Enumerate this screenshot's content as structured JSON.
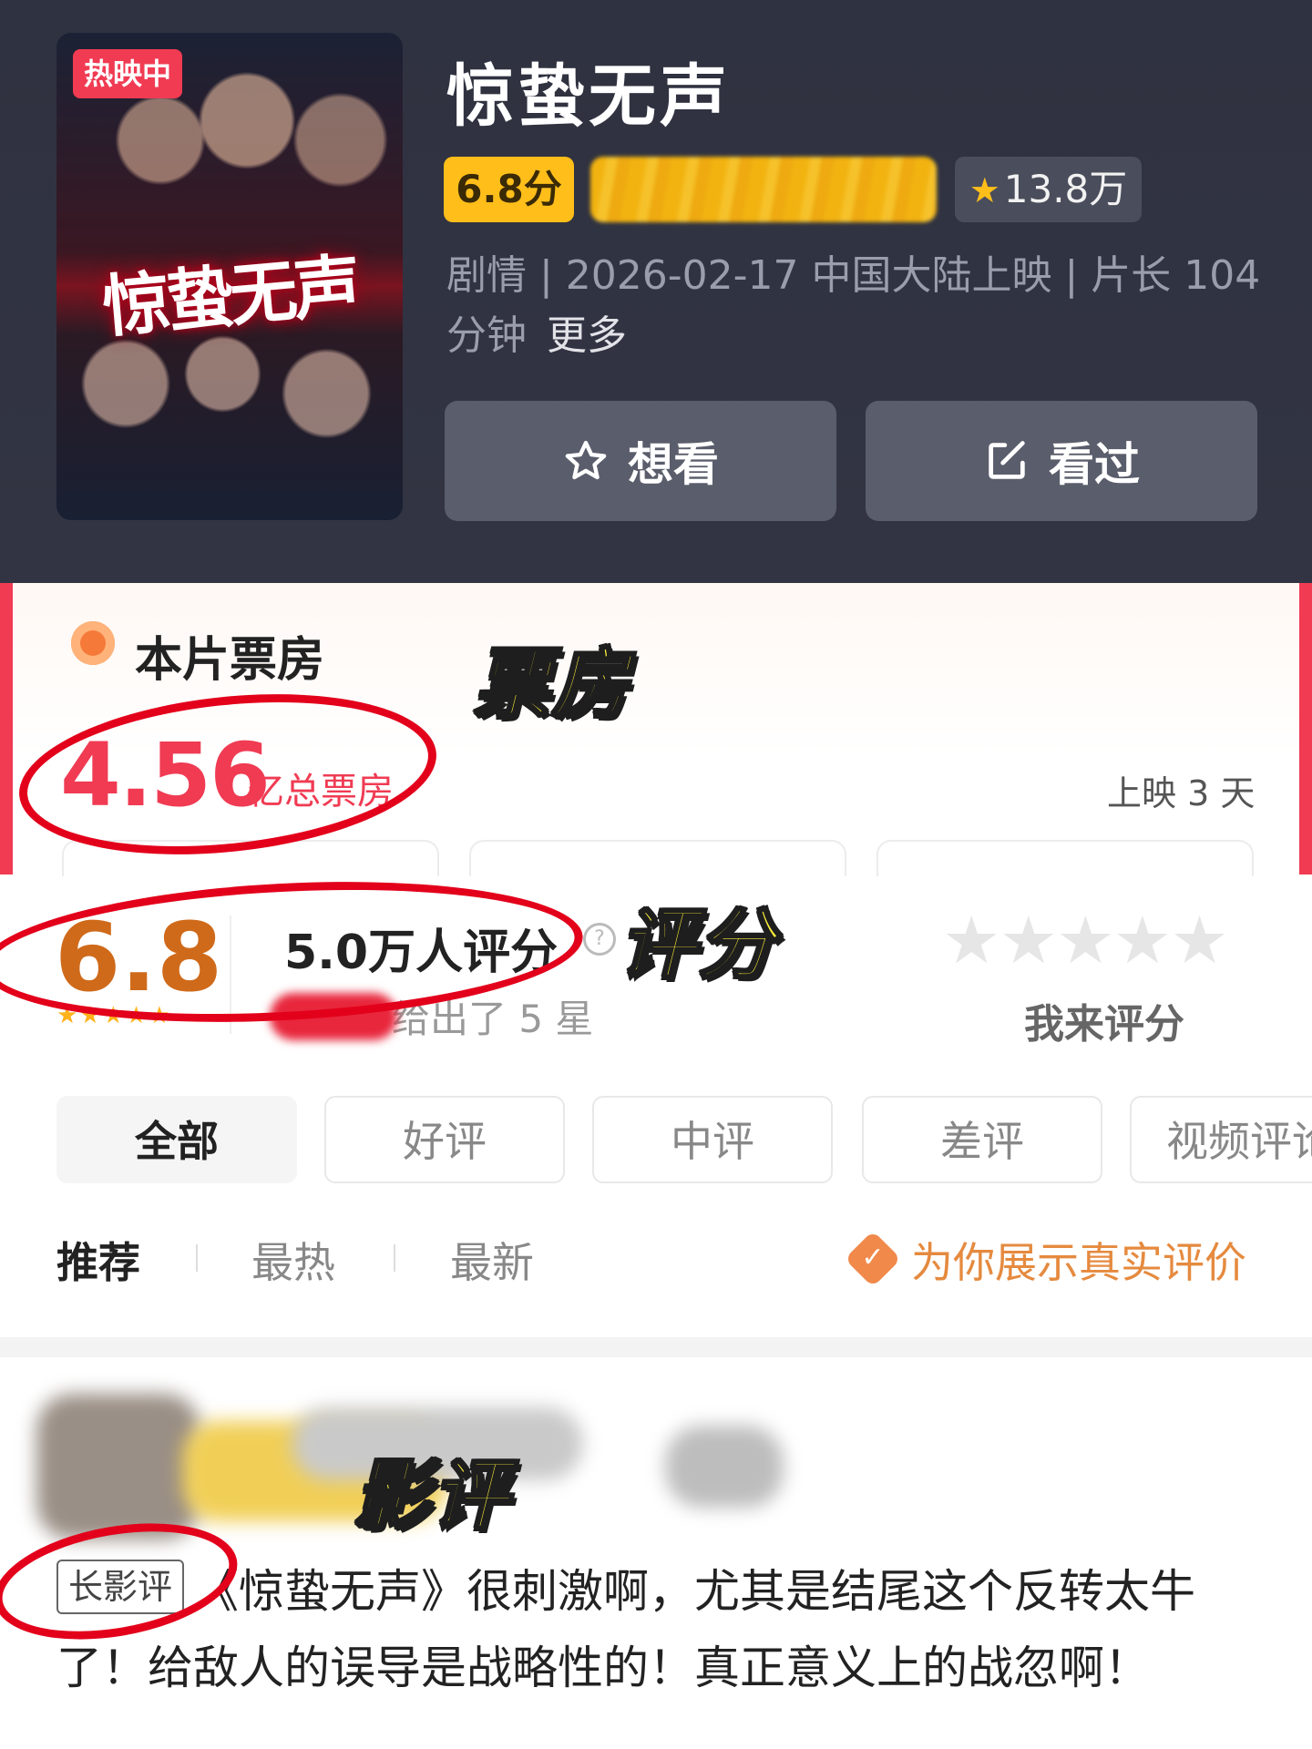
{
  "movie": {
    "status_badge": "热映中",
    "poster_title": "惊蛰无声",
    "title": "惊蛰无声",
    "score_label": "6.8分",
    "want_count": "13.8万",
    "info": "剧情 | 2026-02-17 中国大陆上映 | 片长 104分钟",
    "more_label": "更多",
    "want_button": "想看",
    "seen_button": "看过"
  },
  "box_office": {
    "heading": "本片票房",
    "value": "4.56",
    "unit": "亿总票房",
    "days": "上映 3 天"
  },
  "rating": {
    "score": "6.8",
    "stars_display": "★★★★★",
    "count_text": "5.0万人评分",
    "question_mark": "?",
    "sub_text": "给出了 5 星",
    "my_stars": "★★★★★",
    "rate_me": "我来评分"
  },
  "filters": {
    "tabs": [
      "全部",
      "好评",
      "中评",
      "差评",
      "视频评论"
    ],
    "sort": [
      "推荐",
      "最热",
      "最新"
    ],
    "real_review": "为你展示真实评价"
  },
  "review": {
    "tag": "长影评",
    "text": "《惊蛰无声》很刺激啊，尤其是结尾这个反转太牛了！给敌人的误导是战略性的！真正意义上的战忽啊！"
  },
  "annotations": {
    "box_office": "票房",
    "rating": "评分",
    "review": "影评"
  },
  "colors": {
    "header_bg": "#323443",
    "accent_red": "#f03b53",
    "score_yellow": "#ffbe1a",
    "rating_orange": "#cf6a1a",
    "annotation_ring": "#e3001b",
    "sticker_yellow": "#fff23a"
  }
}
